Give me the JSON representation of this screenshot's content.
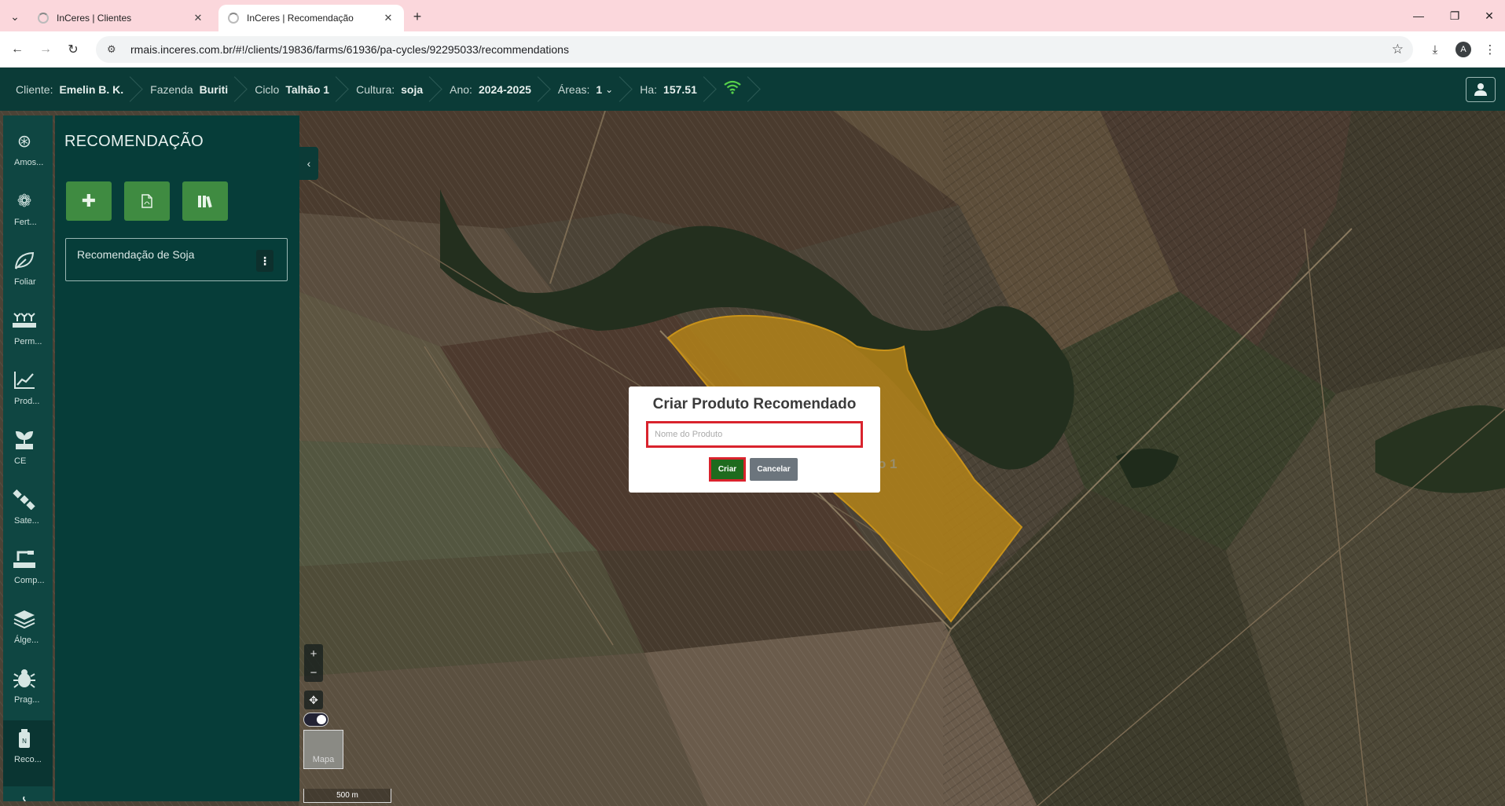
{
  "browser": {
    "tabs": [
      {
        "title": "InCeres | Clientes",
        "active": false
      },
      {
        "title": "InCeres | Recomendação",
        "active": true
      }
    ],
    "url": "rmais.inceres.com.br/#!/clients/19836/farms/61936/pa-cycles/92295033/recommendations",
    "profile_initial": "A"
  },
  "header": {
    "crumbs": [
      {
        "label": "Cliente:",
        "value": "Emelin B. K."
      },
      {
        "label": "Fazenda",
        "value": "Buriti"
      },
      {
        "label": "Ciclo",
        "value": "Talhão 1"
      },
      {
        "label": "Cultura:",
        "value": "soja"
      },
      {
        "label": "Ano:",
        "value": "2024-2025"
      },
      {
        "label": "Áreas:",
        "value": "1"
      },
      {
        "label": "Ha:",
        "value": "157.51"
      }
    ]
  },
  "rail": {
    "items": [
      {
        "label": "Amos...",
        "icon": "sampling-icon"
      },
      {
        "label": "Fert...",
        "icon": "fertility-icon"
      },
      {
        "label": "Foliar",
        "icon": "leaf-icon"
      },
      {
        "label": "Perm...",
        "icon": "permanent-crop-icon"
      },
      {
        "label": "Prod...",
        "icon": "productivity-chart-icon"
      },
      {
        "label": "CE",
        "icon": "plant-ce-icon"
      },
      {
        "label": "Sate...",
        "icon": "satellite-icon"
      },
      {
        "label": "Comp...",
        "icon": "compaction-icon"
      },
      {
        "label": "Álge...",
        "icon": "layers-icon"
      },
      {
        "label": "Prag...",
        "icon": "bug-icon"
      },
      {
        "label": "Reco...",
        "icon": "recommendation-icon"
      }
    ]
  },
  "panel": {
    "title": "RECOMENDAÇÃO",
    "recommendations": [
      {
        "name": "Recomendação de Soja"
      }
    ]
  },
  "map": {
    "field_label": "o 1",
    "maptype_label": "Mapa",
    "scale_label": "500 m"
  },
  "dialog": {
    "title": "Criar Produto Recomendado",
    "input_placeholder": "Nome do Produto",
    "input_value": "",
    "create_label": "Criar",
    "cancel_label": "Cancelar"
  },
  "colors": {
    "header_bg": "#0b3b37",
    "button_green": "#3f8b41",
    "highlight_red": "#d9232d",
    "field_yellow": "#b8860b"
  }
}
